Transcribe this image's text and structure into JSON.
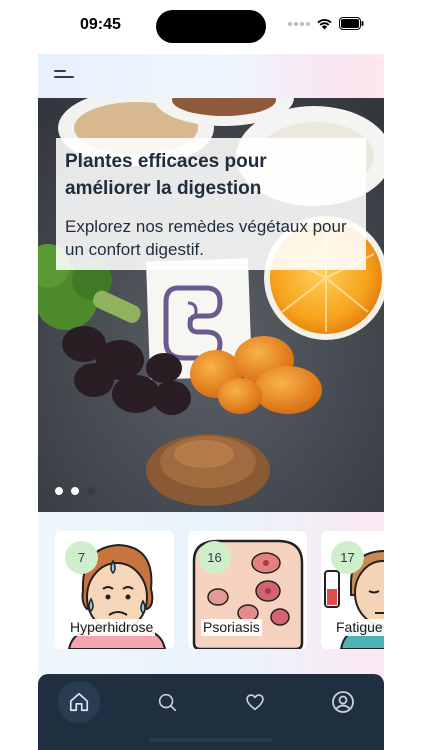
{
  "status_bar": {
    "time": "09:45"
  },
  "header": {
    "menu_icon": "menu-icon"
  },
  "hero": {
    "title": "Plantes efficaces pour améliorer la digestion",
    "subtitle": "Explorez nos remèdes végétaux pour un confort digestif.",
    "slide_count": 3,
    "active_slide": 1
  },
  "categories": [
    {
      "label": "Hyperhidrose",
      "count": "7"
    },
    {
      "label": "Psoriasis",
      "count": "16"
    },
    {
      "label": "Fatigue",
      "count": "17"
    }
  ],
  "tab_bar": {
    "tabs": [
      {
        "icon": "home-icon",
        "active": true
      },
      {
        "icon": "search-icon",
        "active": false
      },
      {
        "icon": "heart-icon",
        "active": false
      },
      {
        "icon": "profile-icon",
        "active": false
      }
    ]
  },
  "colors": {
    "tab_bar_bg": "#1f2f3f",
    "badge_bg": "#cfeecb",
    "title_text": "#1f2d3d"
  }
}
